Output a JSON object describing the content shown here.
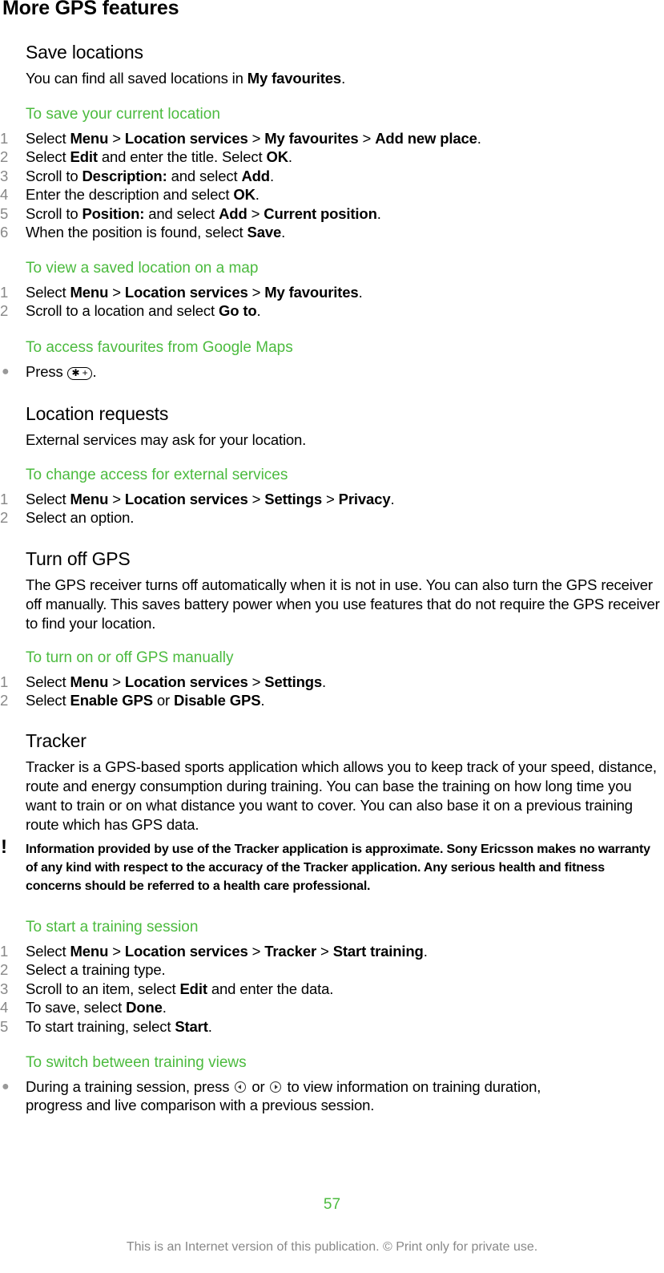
{
  "page": {
    "title": "More GPS features",
    "accent_color": "#4cbb3f",
    "page_number": "57",
    "footer": "This is an Internet version of this publication. © Print only for private use."
  },
  "save_locations": {
    "heading": "Save locations",
    "intro_pre": "You can find all saved locations in ",
    "intro_bold": "My favourites",
    "intro_post": ".",
    "save_current": {
      "heading": "To save your current location",
      "steps": [
        {
          "n": "1",
          "parts": [
            "Select ",
            "*Menu",
            " > ",
            "*Location services",
            " > ",
            "*My favourites",
            " > ",
            "*Add new place",
            "."
          ]
        },
        {
          "n": "2",
          "parts": [
            "Select ",
            "*Edit",
            " and enter the title. Select ",
            "*OK",
            "."
          ]
        },
        {
          "n": "3",
          "parts": [
            "Scroll to ",
            "*Description:",
            " and select ",
            "*Add",
            "."
          ]
        },
        {
          "n": "4",
          "parts": [
            "Enter the description and select ",
            "*OK",
            "."
          ]
        },
        {
          "n": "5",
          "parts": [
            "Scroll to ",
            "*Position:",
            " and select ",
            "*Add",
            " > ",
            "*Current position",
            "."
          ]
        },
        {
          "n": "6",
          "parts": [
            "When the position is found, select ",
            "*Save",
            "."
          ]
        }
      ]
    },
    "view_saved": {
      "heading": "To view a saved location on a map",
      "steps": [
        {
          "n": "1",
          "parts": [
            "Select ",
            "*Menu",
            " > ",
            "*Location services",
            " > ",
            "*My favourites",
            "."
          ]
        },
        {
          "n": "2",
          "parts": [
            "Scroll to a location and select ",
            "*Go to",
            "."
          ]
        }
      ]
    },
    "access_google": {
      "heading": "To access favourites from Google Maps",
      "bullet_pre": "Press ",
      "key_label": "✱ +",
      "bullet_post": "."
    }
  },
  "location_requests": {
    "heading": "Location requests",
    "intro": "External services may ask for your location.",
    "change_access": {
      "heading": "To change access for external services",
      "steps": [
        {
          "n": "1",
          "parts": [
            "Select ",
            "*Menu",
            " > ",
            "*Location services",
            " > ",
            "*Settings",
            " > ",
            "*Privacy",
            "."
          ]
        },
        {
          "n": "2",
          "parts": [
            "Select an option."
          ]
        }
      ]
    }
  },
  "turn_off_gps": {
    "heading": "Turn off GPS",
    "intro": "The GPS receiver turns off automatically when it is not in use. You can also turn the GPS receiver off manually. This saves battery power when you use features that do not require the GPS receiver to find your location.",
    "manual": {
      "heading": "To turn on or off GPS manually",
      "steps": [
        {
          "n": "1",
          "parts": [
            "Select ",
            "*Menu",
            " > ",
            "*Location services",
            " > ",
            "*Settings",
            "."
          ]
        },
        {
          "n": "2",
          "parts": [
            "Select ",
            "*Enable GPS",
            " or ",
            "*Disable GPS",
            "."
          ]
        }
      ]
    }
  },
  "tracker": {
    "heading": "Tracker",
    "intro": "Tracker is a GPS-based sports application which allows you to keep track of your speed, distance, route and energy consumption during training. You can base the training on how long time you want to train or on what distance you want to cover. You can also base it on a previous training route which has GPS data.",
    "note_icon": "!",
    "note": "Information provided by use of the Tracker application is approximate. Sony Ericsson makes no warranty of any kind with respect to the accuracy of the Tracker application. Any serious health and fitness concerns should be referred to a health care professional.",
    "start_session": {
      "heading": "To start a training session",
      "steps": [
        {
          "n": "1",
          "parts": [
            "Select ",
            "*Menu",
            " > ",
            "*Location services",
            " > ",
            "*Tracker",
            " > ",
            "*Start training",
            "."
          ]
        },
        {
          "n": "2",
          "parts": [
            "Select a training type."
          ]
        },
        {
          "n": "3",
          "parts": [
            "Scroll to an item, select ",
            "*Edit",
            " and enter the data."
          ]
        },
        {
          "n": "4",
          "parts": [
            "To save, select ",
            "*Done",
            "."
          ]
        },
        {
          "n": "5",
          "parts": [
            "To start training, select ",
            "*Start",
            "."
          ]
        }
      ]
    },
    "switch_views": {
      "heading": "To switch between training views",
      "line1_pre": "During a training session, press ",
      "line1_mid": " or ",
      "line1_post": " to view information on training duration,",
      "line2": "progress and live comparison with a previous session."
    }
  }
}
